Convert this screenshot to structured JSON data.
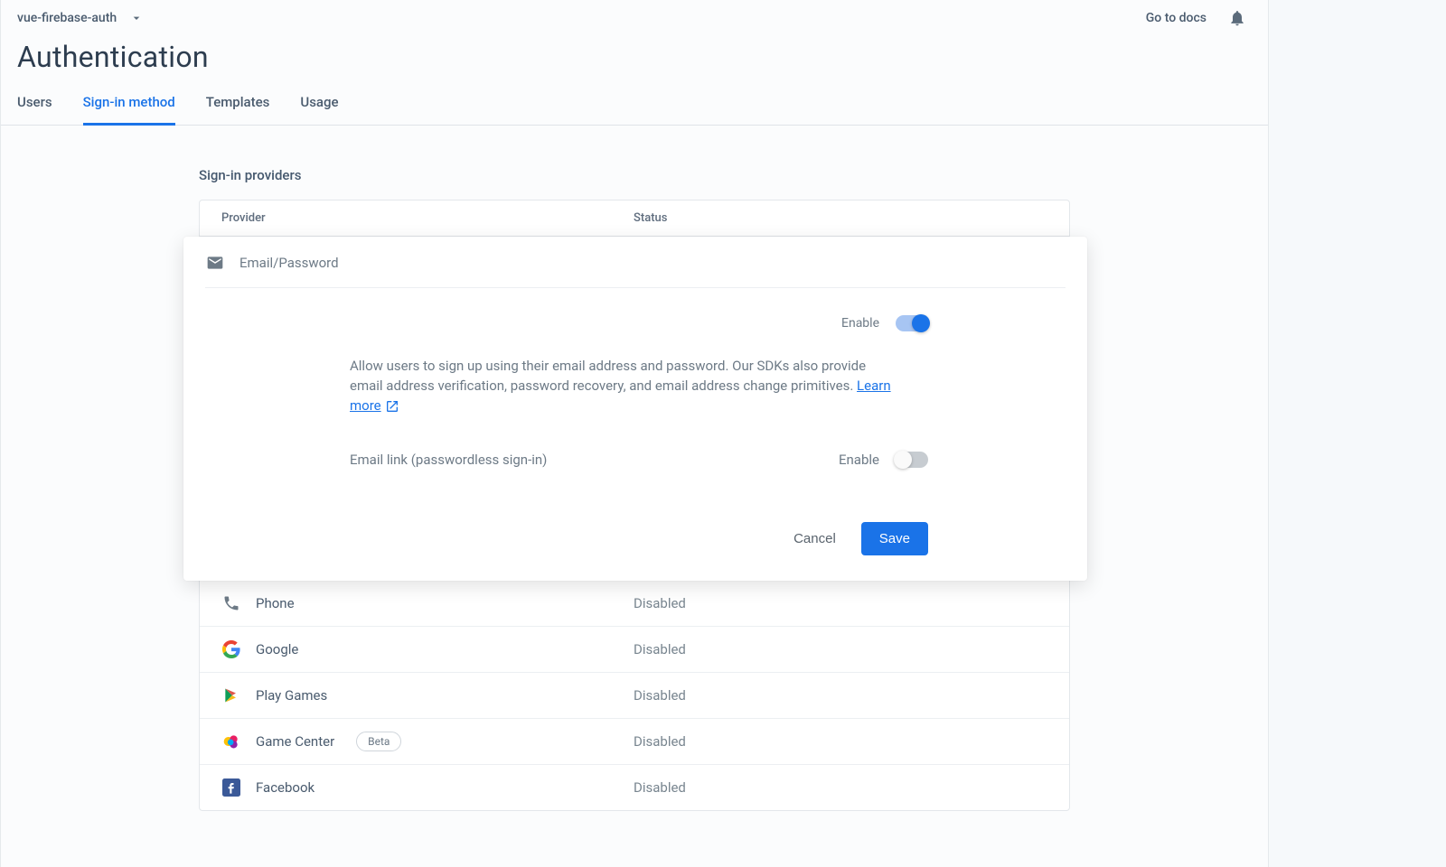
{
  "header": {
    "project_name": "vue-firebase-auth",
    "docs_link": "Go to docs"
  },
  "page_title": "Authentication",
  "tabs": {
    "users": "Users",
    "signin": "Sign-in method",
    "templates": "Templates",
    "usage": "Usage",
    "active": "signin"
  },
  "section_title": "Sign-in providers",
  "table_headers": {
    "provider": "Provider",
    "status": "Status"
  },
  "expanded": {
    "provider_name": "Email/Password",
    "enable_label": "Enable",
    "enable_on": true,
    "help_text": "Allow users to sign up using their email address and password. Our SDKs also provide email address verification, password recovery, and email address change primitives. ",
    "learn_more": "Learn more",
    "passwordless_label": "Email link (passwordless sign-in)",
    "passwordless_enable_label": "Enable",
    "passwordless_on": false,
    "cancel": "Cancel",
    "save": "Save"
  },
  "providers": [
    {
      "name": "Phone",
      "status": "Disabled",
      "icon": "phone"
    },
    {
      "name": "Google",
      "status": "Disabled",
      "icon": "google"
    },
    {
      "name": "Play Games",
      "status": "Disabled",
      "icon": "play"
    },
    {
      "name": "Game Center",
      "status": "Disabled",
      "icon": "gamecenter",
      "badge": "Beta"
    },
    {
      "name": "Facebook",
      "status": "Disabled",
      "icon": "facebook"
    }
  ]
}
